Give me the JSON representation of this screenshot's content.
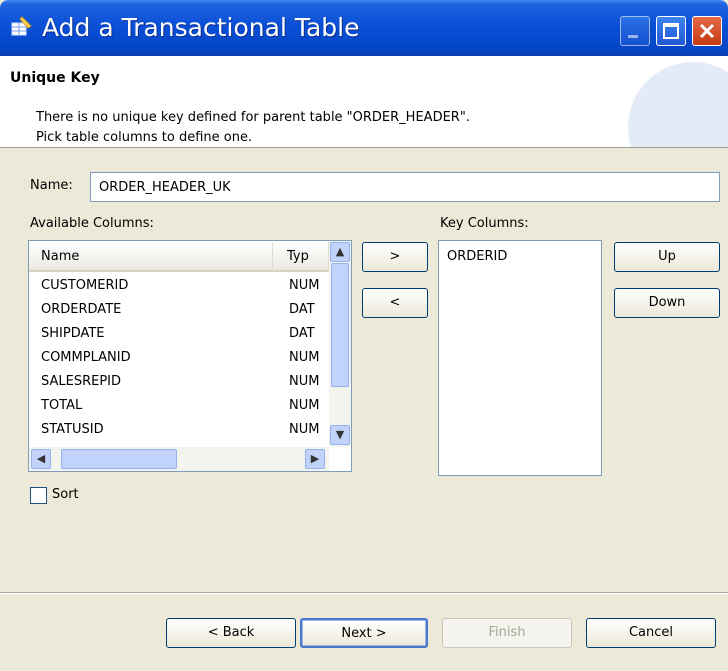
{
  "window": {
    "title": "Add a Transactional Table",
    "controls": [
      "minimize-icon",
      "maximize-icon",
      "close-icon"
    ]
  },
  "banner": {
    "title": "Unique Key",
    "message_line1": "There is no unique key defined for parent table \"ORDER_HEADER\".",
    "message_line2": "Pick table columns to define one."
  },
  "name_field": {
    "label": "Name:",
    "value": "ORDER_HEADER_UK"
  },
  "available_columns": {
    "label": "Available Columns:",
    "headers": [
      "Name",
      "Typ"
    ],
    "rows": [
      {
        "name": "CUSTOMERID",
        "type": "NUM"
      },
      {
        "name": "ORDERDATE",
        "type": "DAT"
      },
      {
        "name": "SHIPDATE",
        "type": "DAT"
      },
      {
        "name": "COMMPLANID",
        "type": "NUM"
      },
      {
        "name": "SALESREPID",
        "type": "NUM"
      },
      {
        "name": "TOTAL",
        "type": "NUM"
      },
      {
        "name": "STATUSID",
        "type": "NUM"
      }
    ]
  },
  "transfer": {
    "add_label": ">",
    "remove_label": "<"
  },
  "key_columns": {
    "label": "Key Columns:",
    "items": [
      "ORDERID"
    ]
  },
  "order": {
    "up_label": "Up",
    "down_label": "Down"
  },
  "sort": {
    "label": "Sort",
    "checked": false
  },
  "footer": {
    "back_label": "< Back",
    "next_label": "Next >",
    "finish_label": "Finish",
    "cancel_label": "Cancel"
  },
  "colors": {
    "titlebar": "#0a4fd6",
    "dialog_bg": "#ece9d8",
    "scroll_thumb": "#c2d3fb",
    "default_button_border": "#4a78c8"
  }
}
